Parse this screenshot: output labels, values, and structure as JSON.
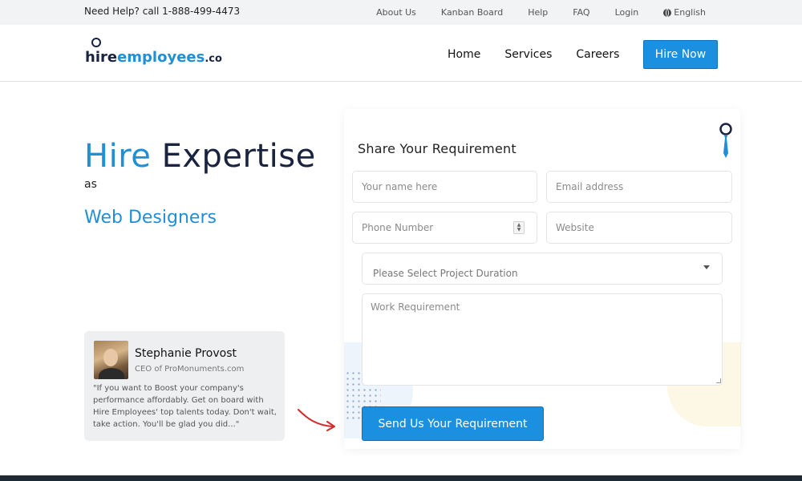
{
  "topbar": {
    "help_text": "Need Help? call 1-888-499-4473",
    "links": [
      "About Us",
      "Kanban Board",
      "Help",
      "FAQ",
      "Login"
    ],
    "language": "English"
  },
  "header": {
    "logo": {
      "part1": "hire",
      "part2": "employees",
      "part3": ".co"
    },
    "nav": [
      "Home",
      "Services",
      "Careers"
    ],
    "cta_label": "Hire Now"
  },
  "hero": {
    "title_word1": "Hire",
    "title_word2": "Expertise",
    "as_text": "as",
    "role": "Web Designers"
  },
  "testimonial": {
    "name": "Stephanie Provost",
    "role": "CEO of ProMonuments.com",
    "quote": "\"If you want to Boost your company's performance affordably. Get on board with Hire Employees' top talents today. Don't wait, take action. You'll be glad you did...\""
  },
  "form": {
    "title": "Share Your Requirement",
    "name_placeholder": "Your name here",
    "email_placeholder": "Email address",
    "phone_placeholder": "Phone Number",
    "website_placeholder": "Website",
    "duration_selected": "Please Select Project Duration",
    "requirement_placeholder": "Work Requirement",
    "submit_label": "Send Us Your Requirement"
  },
  "colors": {
    "accent": "#1b8fe0",
    "brand_dark": "#1a2340",
    "brand_blue": "#1f8fd6",
    "arrow_red": "#d42a2a"
  },
  "icons": {
    "language": "globe-icon",
    "form_decoration": "tie-icon",
    "select_caret": "caret-down-icon",
    "arrow": "curved-arrow-icon"
  }
}
